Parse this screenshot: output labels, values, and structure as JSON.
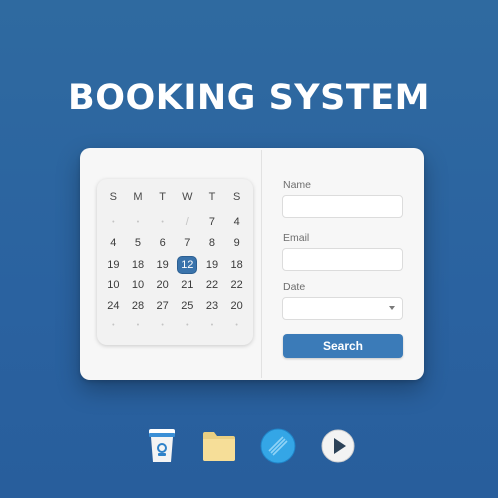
{
  "header": {
    "title": "BOOKING SYSTEM"
  },
  "calendar": {
    "weekdays": [
      "S",
      "M",
      "T",
      "W",
      "T",
      "S"
    ],
    "weeks": [
      [
        "•",
        "•",
        "•",
        "/",
        "7",
        "4"
      ],
      [
        "4",
        "5",
        "6",
        "7",
        "8",
        "9"
      ],
      [
        "19",
        "18",
        "19",
        "12",
        "19",
        "18"
      ],
      [
        "10",
        "10",
        "20",
        "21",
        "22",
        "22"
      ],
      [
        "24",
        "28",
        "27",
        "25",
        "23",
        "20"
      ],
      [
        "•",
        "•",
        "•",
        "•",
        "•",
        "•"
      ]
    ],
    "selected_date": "12"
  },
  "form": {
    "name_label": "Name",
    "name_value": "",
    "email_label": "Email",
    "email_value": "",
    "date_label": "Date",
    "date_value": "",
    "search_label": "Search"
  },
  "dock": {
    "icons": [
      "cup-icon",
      "folder-icon",
      "globe-icon",
      "play-icon"
    ]
  },
  "colors": {
    "background": "#2a62a0",
    "accent": "#3b7bb8",
    "selected_day": "#3a73ab",
    "card": "#f7f7f7"
  }
}
